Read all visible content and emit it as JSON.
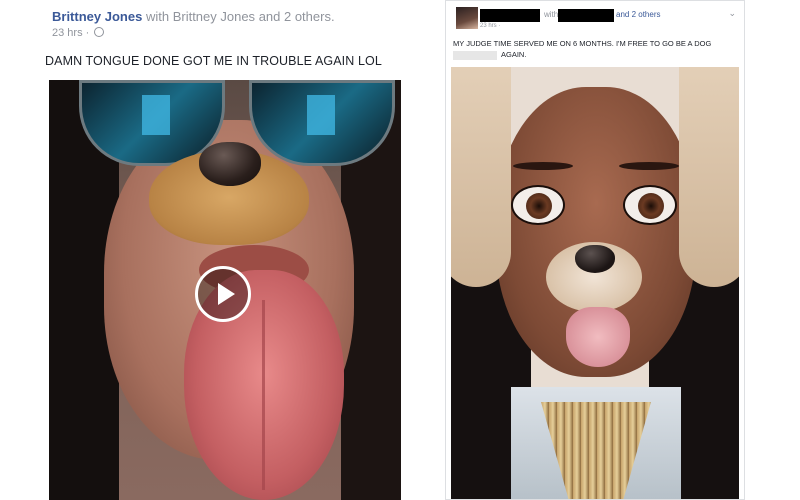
{
  "left_post": {
    "author": "Brittney Jones",
    "with_text": "with",
    "tagged": "Brittney Jones",
    "and_others": "and 2 others.",
    "timestamp": "23 hrs ·",
    "caption": "DAMN TONGUE DONE GOT ME IN TROUBLE AGAIN LOL",
    "video": {
      "play_icon": "play-icon"
    }
  },
  "right_post": {
    "with_text": "with",
    "and_others": "and 2 others",
    "timestamp": "23 hrs ·",
    "caption": "MY JUDGE TIME SERVED ME ON 6 MONTHS. I'M FREE TO GO BE A DOG",
    "caption_end": "AGAIN.",
    "menu_icon": "chevron-down-icon"
  }
}
